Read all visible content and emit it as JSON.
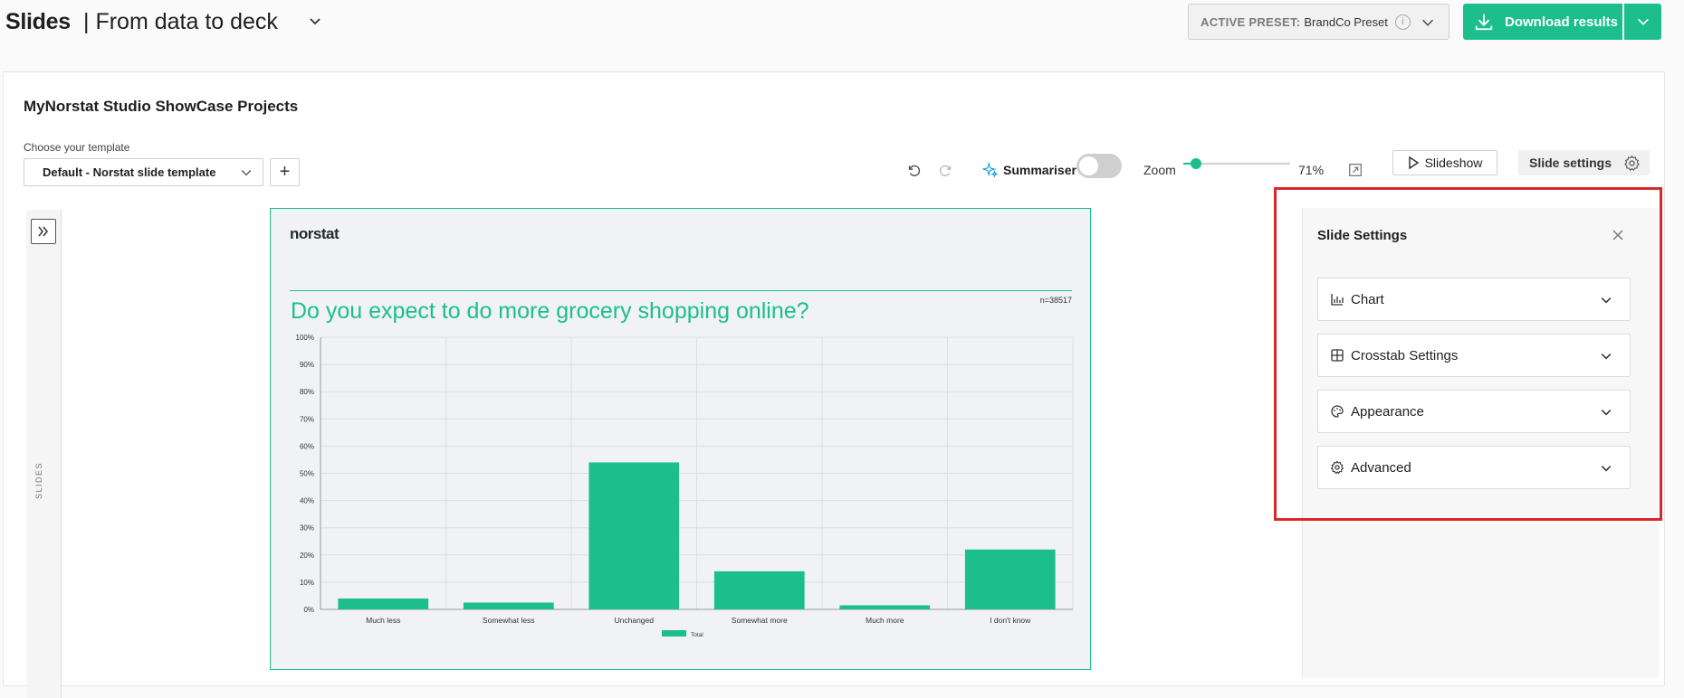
{
  "header": {
    "app_title": "Slides",
    "project_title": "| From data to deck",
    "preset_label": "ACTIVE PRESET:",
    "preset_value": "BrandCo Preset",
    "download_label": "Download results"
  },
  "project": {
    "name": "MyNorstat Studio ShowCase Projects",
    "template_label": "Choose your template",
    "template_value": "Default - Norstat slide template"
  },
  "toolbar": {
    "summariser_label": "Summariser",
    "summariser_on": false,
    "zoom_label": "Zoom",
    "zoom_value": "71%",
    "zoom_fraction": 0.12,
    "slideshow_label": "Slideshow",
    "slide_settings_label": "Slide settings"
  },
  "rail": {
    "label": "SLIDES"
  },
  "slide": {
    "logo": "norstat",
    "question": "Do you expect to do more grocery shopping online?",
    "sample": "n=38517"
  },
  "chart_data": {
    "type": "bar",
    "categories": [
      "Much less",
      "Somewhat less",
      "Unchanged",
      "Somewhat more",
      "Much more",
      "I don't know"
    ],
    "series": [
      {
        "name": "Total",
        "values": [
          4,
          2.5,
          54,
          14,
          1.5,
          22
        ]
      }
    ],
    "ylim": [
      0,
      100
    ],
    "yticks": [
      "0%",
      "10%",
      "20%",
      "30%",
      "40%",
      "50%",
      "60%",
      "70%",
      "80%",
      "90%",
      "100%"
    ],
    "color": "#1cbf8c",
    "grid": true,
    "legend": "bottom-center"
  },
  "panel": {
    "title": "Slide Settings",
    "sections": [
      {
        "label": "Chart",
        "icon": "bar-chart-icon"
      },
      {
        "label": "Crosstab Settings",
        "icon": "table-icon"
      },
      {
        "label": "Appearance",
        "icon": "palette-icon"
      },
      {
        "label": "Advanced",
        "icon": "gear-icon"
      }
    ]
  },
  "colors": {
    "accent": "#1cbf8c",
    "highlight": "#d9282a"
  }
}
